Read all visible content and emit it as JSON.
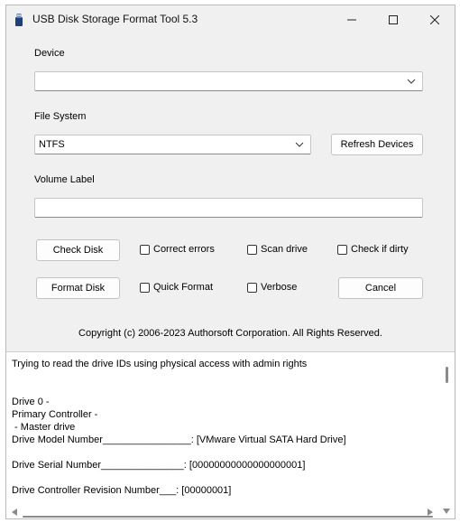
{
  "window": {
    "title": "USB Disk Storage Format Tool 5.3",
    "icon": "usb-drive-icon"
  },
  "titlebar_buttons": [
    "minimize-icon",
    "maximize-icon",
    "close-icon"
  ],
  "device": {
    "label": "Device",
    "value": ""
  },
  "file_system": {
    "label": "File System",
    "value": "NTFS"
  },
  "volume_label": {
    "label": "Volume Label",
    "value": ""
  },
  "buttons": {
    "refresh": "Refresh Devices",
    "check_disk": "Check Disk",
    "format_disk": "Format Disk",
    "cancel": "Cancel"
  },
  "checkboxes": {
    "correct_errors": {
      "label": "Correct errors",
      "checked": false
    },
    "scan_drive": {
      "label": "Scan drive",
      "checked": false
    },
    "check_if_dirty": {
      "label": "Check if dirty",
      "checked": false
    },
    "quick_format": {
      "label": "Quick Format",
      "checked": false
    },
    "verbose": {
      "label": "Verbose",
      "checked": false
    }
  },
  "copyright": "Copyright (c) 2006-2023 Authorsoft Corporation. All Rights Reserved.",
  "log": [
    "Trying to read the drive IDs using physical access with admin rights",
    "",
    "",
    "Drive 0 -",
    "Primary Controller -",
    " - Master drive",
    "Drive Model Number________________: [VMware Virtual SATA Hard Drive]",
    "",
    "Drive Serial Number_______________: [00000000000000000001]",
    "",
    "Drive Controller Revision Number___: [00000001]"
  ]
}
